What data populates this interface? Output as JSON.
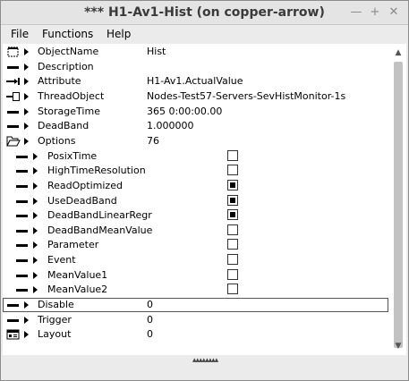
{
  "window": {
    "title": "*** H1-Av1-Hist (on copper-arrow)",
    "min_icon": "—",
    "max_icon": "+",
    "close_icon": "✕"
  },
  "menu": [
    "File",
    "Functions",
    "Help"
  ],
  "rows": [
    {
      "name": "ObjectName",
      "value": "Hist",
      "icon": "object-icon",
      "sub": false
    },
    {
      "name": "Description",
      "value": "",
      "icon": "dash-icon",
      "sub": false
    },
    {
      "name": "Attribute",
      "value": "H1-Av1.ActualValue",
      "icon": "attrref-icon",
      "sub": false
    },
    {
      "name": "ThreadObject",
      "value": "Nodes-Test57-Servers-SevHistMonitor-1s",
      "icon": "objref-icon",
      "sub": false
    },
    {
      "name": "StorageTime",
      "value": "365 0:00:00.00",
      "icon": "dash-icon",
      "sub": false
    },
    {
      "name": "DeadBand",
      "value": "1.000000",
      "icon": "dash-icon",
      "sub": false
    },
    {
      "name": "Options",
      "value": "76",
      "icon": "folder-open-icon",
      "sub": false
    },
    {
      "name": "PosixTime",
      "checked": false,
      "sub": true
    },
    {
      "name": "HighTimeResolution",
      "checked": false,
      "sub": true
    },
    {
      "name": "ReadOptimized",
      "checked": true,
      "sub": true
    },
    {
      "name": "UseDeadBand",
      "checked": true,
      "sub": true
    },
    {
      "name": "DeadBandLinearRegr",
      "checked": true,
      "sub": true
    },
    {
      "name": "DeadBandMeanValue",
      "checked": false,
      "sub": true
    },
    {
      "name": "Parameter",
      "checked": false,
      "sub": true
    },
    {
      "name": "Event",
      "checked": false,
      "sub": true
    },
    {
      "name": "MeanValue1",
      "checked": false,
      "sub": true
    },
    {
      "name": "MeanValue2",
      "checked": false,
      "sub": true
    },
    {
      "name": "Disable",
      "value": "0",
      "icon": "dash-icon",
      "sub": false,
      "selected": true
    },
    {
      "name": "Trigger",
      "value": "0",
      "icon": "dash-icon",
      "sub": false
    },
    {
      "name": "Layout",
      "value": "0",
      "icon": "layout-icon",
      "sub": false
    }
  ],
  "scrollbar": {
    "up_arrow": "▲",
    "down_arrow": "▼"
  },
  "bottom": {
    "grip": "▴▴▴▴▴▴▴▴"
  }
}
